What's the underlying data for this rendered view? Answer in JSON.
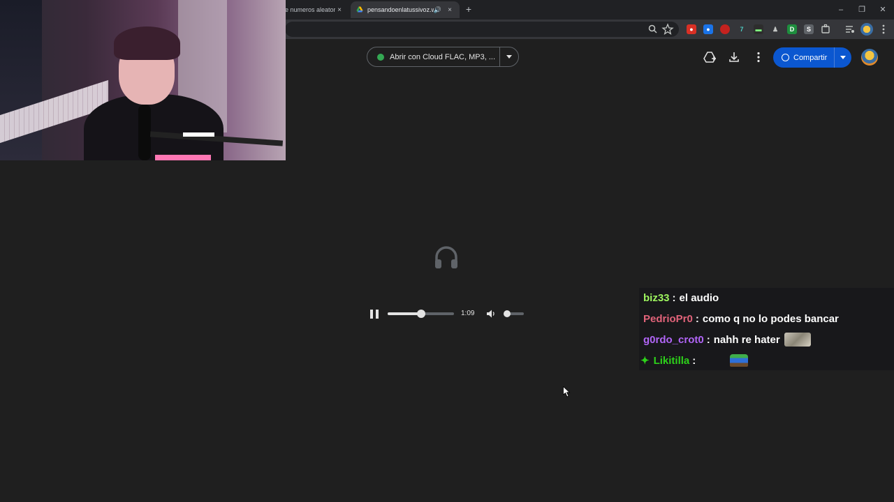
{
  "browser": {
    "tabs": [
      {
        "title": "e numeros aleatori",
        "active": false
      },
      {
        "title": "pensandoenlatussivoz.wav",
        "active": true,
        "audio": true
      }
    ],
    "new_tab_symbol": "+",
    "close_symbol": "×",
    "window_controls": [
      "–",
      "❐",
      "✕"
    ]
  },
  "drive": {
    "open_with_label": "Abrir con Cloud FLAC, MP3, ...",
    "share_label": "Compartir",
    "header_icons": [
      "add-to-drive-icon",
      "download-icon",
      "more-vert-icon"
    ]
  },
  "player": {
    "time": "1:09",
    "progress": 0.5,
    "volume": 0.05,
    "state": "playing"
  },
  "chat": {
    "messages": [
      {
        "user": "biz33",
        "color": "#9ef55f",
        "text": "el audio",
        "emote": false
      },
      {
        "user": "PedrioPr0",
        "color": "#e2637a",
        "text": "como q no lo podes bancar",
        "emote": false
      },
      {
        "user": "g0rdo_crot0",
        "color": "#b165f7",
        "text": "nahh re hater",
        "emote": true
      },
      {
        "user": "Likitilla",
        "color": "#2dd11a",
        "text": "",
        "emote": true,
        "badge": "star"
      }
    ]
  },
  "colors": {
    "background": "#1f1f1f",
    "share_button": "#0b57d0",
    "chat_background": "#18181b"
  }
}
